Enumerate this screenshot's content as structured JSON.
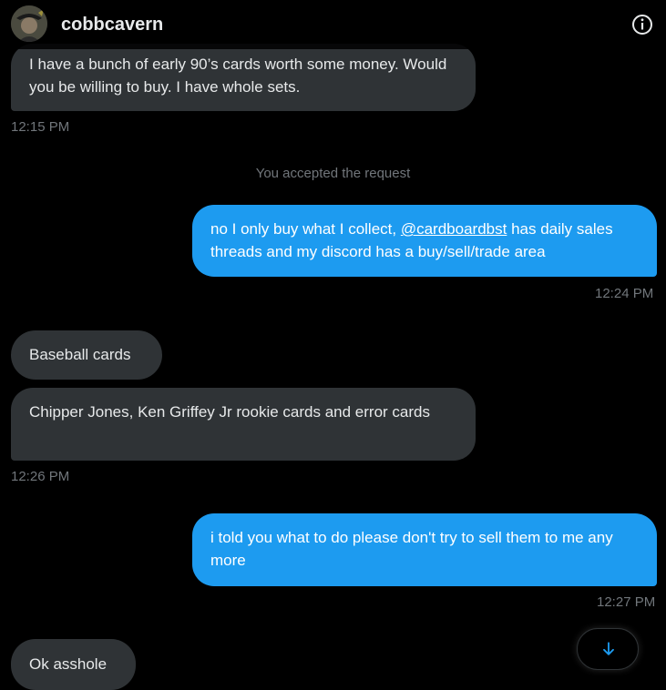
{
  "header": {
    "username": "cobbcavern",
    "avatar_icon": "avatar-icon",
    "info_icon": "info-icon"
  },
  "messages": [
    {
      "direction": "in",
      "text": "I have a bunch of early 90’s cards worth some money. Would you be willing to buy. I have whole sets.",
      "time": "12:15 PM"
    },
    {
      "direction": "system",
      "text": "You accepted the request"
    },
    {
      "direction": "out",
      "text_before": "no I only buy what I collect, ",
      "mention": "@cardboardbst",
      "text_after": " has daily sales threads and my discord has a buy/sell/trade area",
      "time": "12:24 PM"
    },
    {
      "direction": "in",
      "text": "Baseball cards"
    },
    {
      "direction": "in",
      "text": "Chipper Jones, Ken Griffey Jr rookie cards and error cards",
      "time": "12:26 PM"
    },
    {
      "direction": "out",
      "text": "i told you what to do please don't try to sell them to me any more",
      "time": "12:27 PM"
    },
    {
      "direction": "in",
      "text": "Ok asshole"
    }
  ],
  "scroll_button": {
    "icon": "arrow-down-icon"
  },
  "colors": {
    "background": "#000000",
    "incoming_bubble": "#2f3336",
    "outgoing_bubble": "#1d9bf0",
    "timestamp": "#71767b",
    "text": "#e7e9ea"
  }
}
